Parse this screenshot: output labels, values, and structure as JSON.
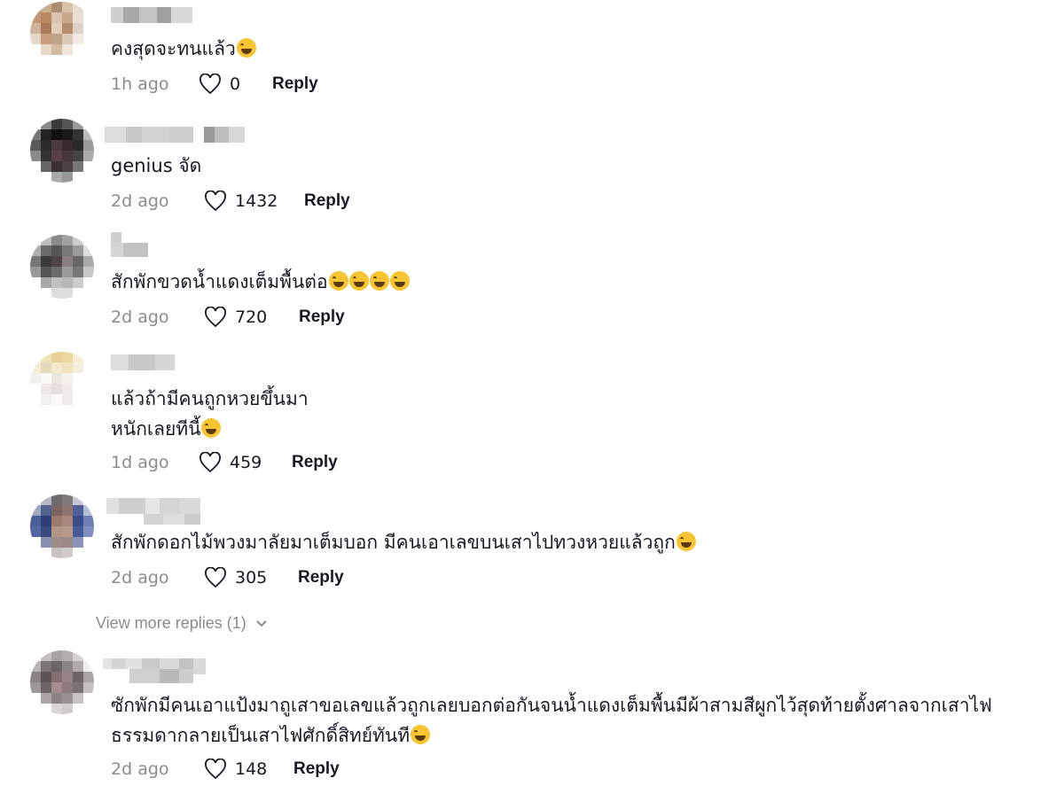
{
  "comments": [
    {
      "text": "คงสุดจะทนแล้ว",
      "emoji": "sweat-smile-emoji",
      "emoji_count": 1,
      "ago": "1h ago",
      "likes": "0",
      "reply": "Reply"
    },
    {
      "text": "genius จัด",
      "emoji": "",
      "emoji_count": 0,
      "ago": "2d ago",
      "likes": "1432",
      "reply": "Reply"
    },
    {
      "text": "สักพักขวดน้ำแดงเต็มพื้นต่อ",
      "emoji": "joy-emoji",
      "emoji_count": 4,
      "ago": "2d ago",
      "likes": "720",
      "reply": "Reply"
    },
    {
      "text": "แล้วถ้ามีคนถูกหวยขึ้นมา\nหนักเลยทีนี้",
      "emoji": "joy-emoji",
      "emoji_count": 1,
      "ago": "1d ago",
      "likes": "459",
      "reply": "Reply"
    },
    {
      "text": "สักพักดอกไม้พวงมาลัยมาเต็มบอก มีคนเอาเลขบนเสาไปทวงหวยแล้วถูก",
      "emoji": "sweat-smile-emoji",
      "emoji_count": 1,
      "ago": "2d ago",
      "likes": "305",
      "reply": "Reply"
    },
    {
      "text": "ซักพักมีคนเอาแป้งมาถูเสาขอเลขแล้วถูกเลยบอกต่อกันจนน้ำแดงเต็มพื้นมีผ้าสามสีผูกไว้สุดท้ายตั้งศาลจากเสาไฟ\nธรรมดากลายเป็นเสาไฟศักดิ์สิทย์ทันที",
      "emoji": "joy-emoji",
      "emoji_count": 1,
      "ago": "2d ago",
      "likes": "148",
      "reply": "Reply"
    }
  ],
  "view_more": "View more replies (1)",
  "colors": {
    "meta": "#8a8b91",
    "text": "#161823"
  }
}
